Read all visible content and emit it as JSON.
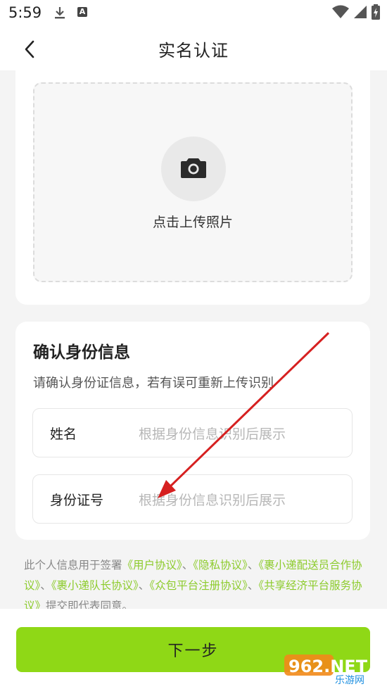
{
  "status_bar": {
    "time": "5:59"
  },
  "header": {
    "title": "实名认证"
  },
  "upload": {
    "label": "点击上传照片"
  },
  "info": {
    "title": "确认身份信息",
    "subtitle": "请确认身份证信息，若有误可重新上传识别",
    "fields": [
      {
        "label": "姓名",
        "placeholder": "根据身份信息识别后展示"
      },
      {
        "label": "身份证号",
        "placeholder": "根据身份信息识别后展示"
      }
    ]
  },
  "agreement": {
    "prefix": "此个人信息用于签署",
    "links": [
      "《用户协议》",
      "《隐私协议》",
      "《裹小递配送员合作协议》",
      "《裹小递队长协议》",
      "《众包平台注册协议》",
      "《共享经济平台服务协议》"
    ],
    "separator": "、",
    "suffix": "提交即代表同意。"
  },
  "footer": {
    "next_label": "下一步"
  },
  "watermark": {
    "text_top": "962.NET",
    "text_bottom": "乐游网"
  },
  "colors": {
    "accent": "#8fd816",
    "link": "#8ccb2b",
    "annotation_arrow": "#d62020"
  },
  "icons": [
    "download-icon",
    "a-badge-icon",
    "wifi-icon",
    "signal-icon",
    "battery-icon",
    "back-arrow-icon",
    "camera-icon"
  ]
}
